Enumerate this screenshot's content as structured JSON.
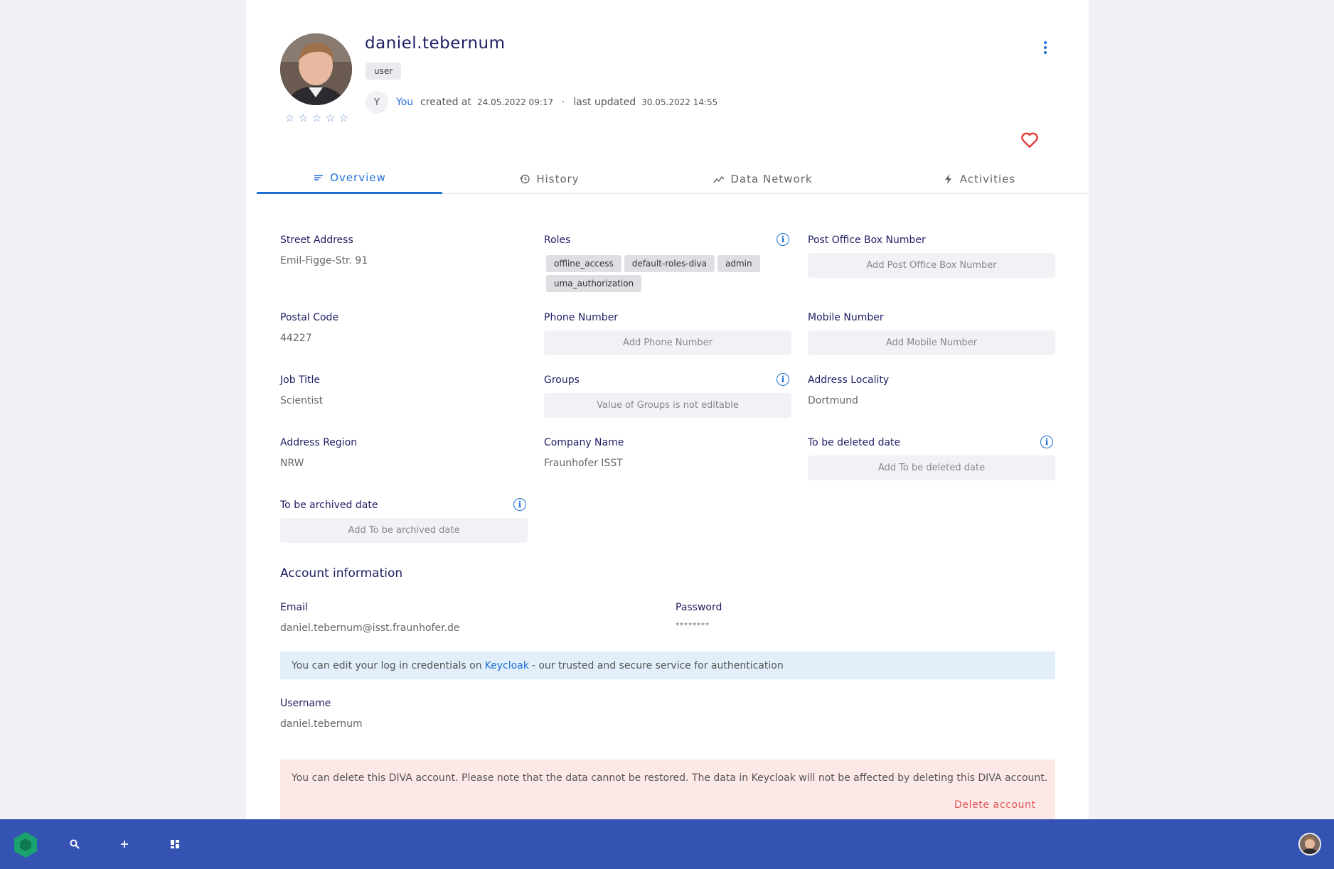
{
  "header": {
    "username": "daniel.tebernum",
    "badge": "user",
    "creator_initial": "Y",
    "creator": "You",
    "created_label": "created at",
    "created_date": "24.05.2022 09:17",
    "separator": "·",
    "updated_label": "last updated",
    "updated_date": "30.05.2022 14:55",
    "rating": 0,
    "rating_max": 5
  },
  "tabs": [
    {
      "label": "Overview",
      "icon": "lines-icon",
      "active": true
    },
    {
      "label": "History",
      "icon": "history-icon",
      "active": false
    },
    {
      "label": "Data Network",
      "icon": "network-icon",
      "active": false
    },
    {
      "label": "Activities",
      "icon": "bolt-icon",
      "active": false
    }
  ],
  "fields": {
    "street_address": {
      "label": "Street Address",
      "value": "Emil-Figge-Str. 91"
    },
    "roles": {
      "label": "Roles",
      "chips": [
        "offline_access",
        "default-roles-diva",
        "admin",
        "uma_authorization"
      ]
    },
    "po_box": {
      "label": "Post Office Box Number",
      "placeholder": "Add Post Office Box Number"
    },
    "postal_code": {
      "label": "Postal Code",
      "value": "44227"
    },
    "phone": {
      "label": "Phone Number",
      "placeholder": "Add Phone Number"
    },
    "mobile": {
      "label": "Mobile Number",
      "placeholder": "Add Mobile Number"
    },
    "job_title": {
      "label": "Job Title",
      "value": "Scientist"
    },
    "groups": {
      "label": "Groups",
      "placeholder": "Value of Groups is not editable"
    },
    "locality": {
      "label": "Address Locality",
      "value": "Dortmund"
    },
    "region": {
      "label": "Address Region",
      "value": "NRW"
    },
    "company": {
      "label": "Company Name",
      "value": "Fraunhofer ISST"
    },
    "deleted_date": {
      "label": "To be deleted date",
      "placeholder": "Add To be deleted date"
    },
    "archived_date": {
      "label": "To be archived date",
      "placeholder": "Add To be archived date"
    }
  },
  "account": {
    "title": "Account information",
    "email_label": "Email",
    "email": "daniel.tebernum@isst.fraunhofer.de",
    "password_label": "Password",
    "password": "********",
    "note_before": "You can edit your log in credentials on",
    "note_link": "Keycloak",
    "note_after": "- our trusted and secure service for authentication",
    "username_label": "Username",
    "username": "daniel.tebernum",
    "delete_note": "You can delete this DIVA account. Please note that the data cannot be restored. The data in Keycloak will not be affected by deleting this DIVA account.",
    "delete_button": "Delete account"
  },
  "bottombar": {
    "icons": [
      "diva-logo-icon",
      "search-icon",
      "plus-icon",
      "dashboard-icon",
      "user-avatar"
    ],
    "colors": {
      "bar": "#3553b2",
      "logo": "#1aa36f"
    }
  },
  "colors": {
    "accent": "#1e6fd6",
    "heading": "#1e1e64",
    "danger": "#e05555"
  }
}
